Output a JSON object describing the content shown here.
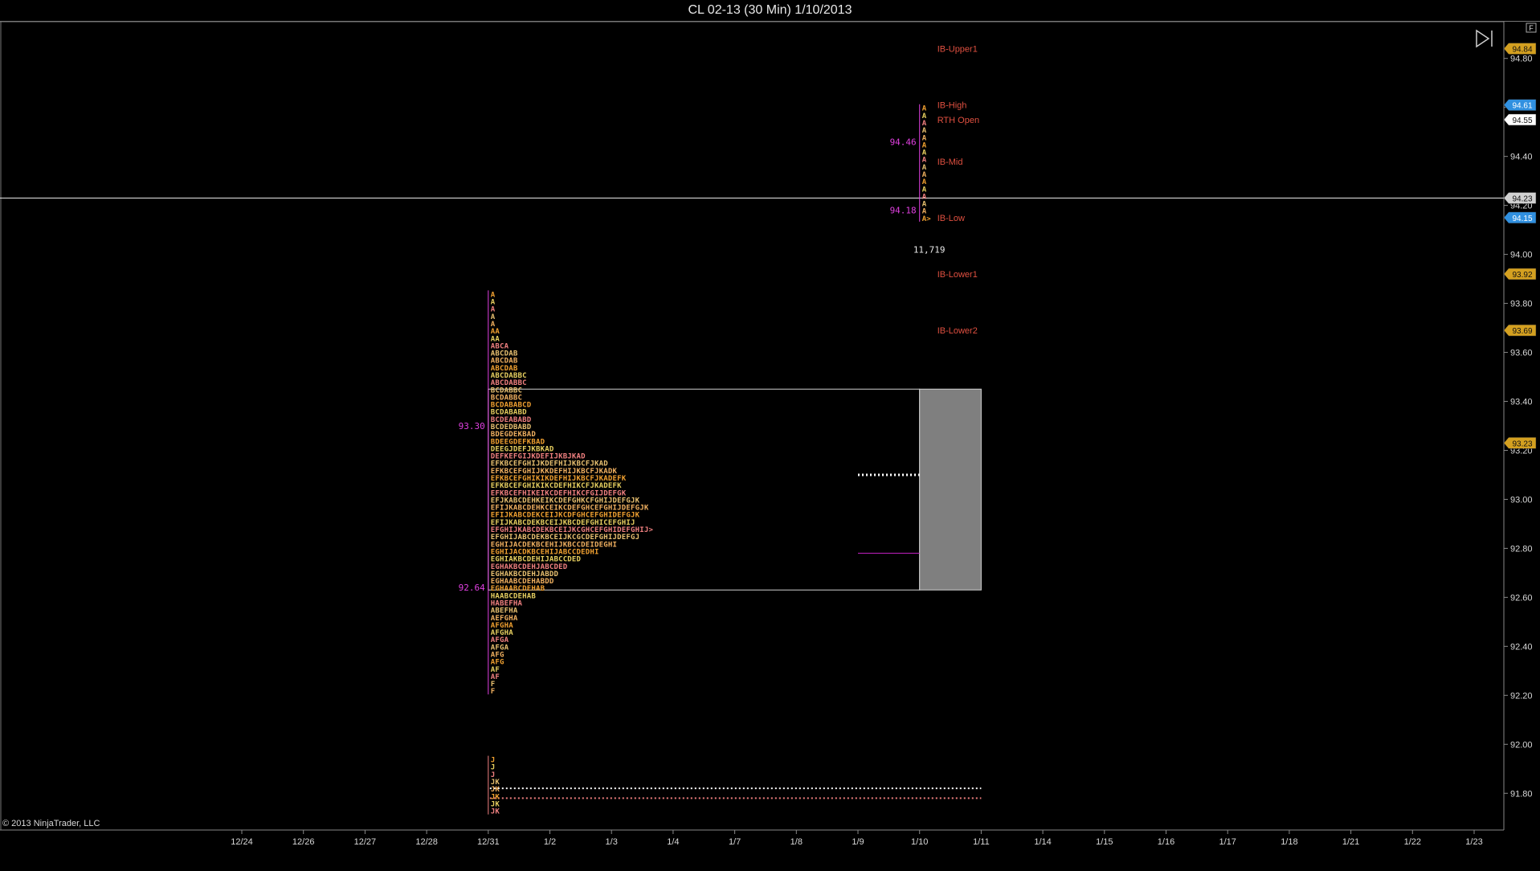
{
  "window": {
    "title": "CL 02-13 (30 Min)  1/10/2013"
  },
  "copyright": "© 2013 NinjaTrader, LLC",
  "toolbar": {
    "corner_label": "F",
    "play_icon": "play-to-end-icon"
  },
  "colors": {
    "background": "#000000",
    "axis": "#888888",
    "text": "#dddddd",
    "orange": "#f0a030",
    "yellow": "#e8d060",
    "pink": "#f08080",
    "magenta": "#e040e0",
    "red_label": "#e05040",
    "gray_box": "#7f7f7f",
    "gold_badge": "#d4a020",
    "blue_badge": "#3090e0"
  },
  "chart_data": {
    "type": "market-profile",
    "ylim": [
      91.65,
      94.95
    ],
    "y_ticks": [
      "94.80",
      "94.60",
      "94.40",
      "94.20",
      "94.00",
      "93.80",
      "93.60",
      "93.40",
      "93.20",
      "93.00",
      "92.80",
      "92.60",
      "92.40",
      "92.20",
      "92.00",
      "91.80"
    ],
    "y_tick_values": [
      94.8,
      94.6,
      94.4,
      94.2,
      94.0,
      93.8,
      93.6,
      93.4,
      93.2,
      93.0,
      92.8,
      92.6,
      92.4,
      92.2,
      92.0,
      91.8
    ],
    "x_ticks": [
      "12/24",
      "12/26",
      "12/27",
      "12/28",
      "12/31",
      "1/2",
      "1/3",
      "1/4",
      "1/7",
      "1/8",
      "1/9",
      "1/10",
      "1/11",
      "1/14",
      "1/15",
      "1/16",
      "1/17",
      "1/18",
      "1/21",
      "1/22",
      "1/23"
    ],
    "price_badges": [
      {
        "label": "94.84",
        "value": 94.84,
        "style": "gold"
      },
      {
        "label": "94.61",
        "value": 94.61,
        "style": "blue"
      },
      {
        "label": "94.55",
        "value": 94.55,
        "style": "white"
      },
      {
        "label": "94.23",
        "value": 94.23,
        "style": "gray"
      },
      {
        "label": "94.15",
        "value": 94.15,
        "style": "blue"
      },
      {
        "label": "93.92",
        "value": 93.92,
        "style": "gold"
      },
      {
        "label": "93.69",
        "value": 93.69,
        "style": "gold"
      },
      {
        "label": "93.23",
        "value": 93.23,
        "style": "gold"
      }
    ],
    "crosshair_price": 94.23,
    "level_labels": [
      {
        "label": "IB-Upper1",
        "value": 94.84
      },
      {
        "label": "IB-High",
        "value": 94.61
      },
      {
        "label": "RTH Open",
        "value": 94.55
      },
      {
        "label": "IB-Mid",
        "value": 94.38
      },
      {
        "label": "IB-Low",
        "value": 94.15
      },
      {
        "label": "IB-Lower1",
        "value": 93.92
      },
      {
        "label": "IB-Lower2",
        "value": 93.69
      }
    ],
    "value_area": {
      "high": 93.45,
      "low": 92.63,
      "from": "12/31",
      "to": "1/10"
    },
    "gray_box": {
      "high": 93.45,
      "low": 92.63,
      "from": "1/10",
      "to": "1/11"
    },
    "poc_dotted": {
      "value": 93.1,
      "from": "1/9",
      "to": "1/10"
    },
    "poc_magenta": {
      "value": 92.78,
      "from": "1/9",
      "to": "1/10"
    },
    "bottom_dotted": [
      {
        "value": 91.82,
        "color": "#ffffff"
      },
      {
        "value": 91.78,
        "color": "#f08080"
      }
    ],
    "profiles": [
      {
        "name": "weekly",
        "anchor": "12/31",
        "top_price": 93.84,
        "step": 0.03,
        "va_high_label": "93.30",
        "va_high": 93.3,
        "va_low_label": "92.64",
        "va_low": 92.64,
        "rows": [
          "A",
          "A",
          "A",
          "A",
          "A",
          "AA",
          "AA",
          "ABCA",
          "ABCDAB",
          "ABCDAB",
          "ABCDAB",
          "ABCDABBC",
          "ABCDABBC",
          "BCDABBC",
          "BCDABBC",
          "BCDABABCD",
          "BCDABABD",
          "BCDEABABD",
          "BCDEDBABD",
          "BDEGDEKBAD",
          "BDEEGDEFKBAD",
          "DEEGJDEFJKBKAD",
          "DEFKEFGIJKDEFIJKBJKAD",
          "EFKBCEFGHIJKDEFHIJKBCFJKAD",
          "EFKBCEFGHIJKKDEFHIJKBCFJKADK",
          "EFKBCEFGHIKIKDEFHIJKBCFJKADEFK",
          "EFKBCEFGHIKIKCDEFHIKCFJKADEFK",
          "EFKBCEFHIKEIKCDEFHIKCFGIJDEFGK",
          "EFJKABCDEHKEIKCDEFGHKCFGHIJDEFGJK",
          "EFIJKABCDEHKCEIKCDEFGHCEFGHIJDEFGJK",
          "EFIJKABCDEKCEIJKCDFGHCEFGHIDEFGJK",
          "EFIJKABCDEKBCEIJKBCDEFGHICEFGHIJ",
          "EFGHIJKABCDEKBCEIJKCGHCEFGHIDEFGHIJ>",
          "EFGHIJABCDEKBCEIJKCGCDEFGHIJDEFGJ",
          "EGHIJACDEKBCEHIJKBCCDEIDEGHI",
          "EGHIJACDKBCEHIJABCCDEDHI",
          "EGHIAKBCDEHIJABCCDED",
          "EGHAKBCDEHJABCDED",
          "EGHAKBCDEHJABDD",
          "EGHAABCDEHABDD",
          "EGHAABCDEHAB",
          "HAABCDEHAB",
          "HABEFHA",
          "ABEFHA",
          "AEFGHA",
          "AFGHA",
          "AFGHA",
          "AFGA",
          "AFGA",
          "AFG",
          "AFG",
          "AF",
          "AF",
          "F",
          "F"
        ]
      },
      {
        "name": "daily",
        "anchor": "1/10",
        "top_price": 94.6,
        "step": 0.03,
        "va_high_label": "94.46",
        "va_high": 94.46,
        "va_low_label": "94.18",
        "va_low": 94.18,
        "rows": [
          "A",
          "A",
          "A",
          "A",
          "A",
          "A",
          "A",
          "A",
          "A",
          "A",
          "A",
          "A",
          "A",
          "A",
          "A",
          "A>"
        ],
        "volume_label": "11,719",
        "volume_price": 94.02
      },
      {
        "name": "bottom",
        "anchor": "12/31",
        "top_price": 91.94,
        "step": 0.03,
        "rows": [
          "J",
          "J",
          "J",
          "JK",
          "JK",
          "JK",
          "JK",
          "JK"
        ]
      }
    ]
  }
}
